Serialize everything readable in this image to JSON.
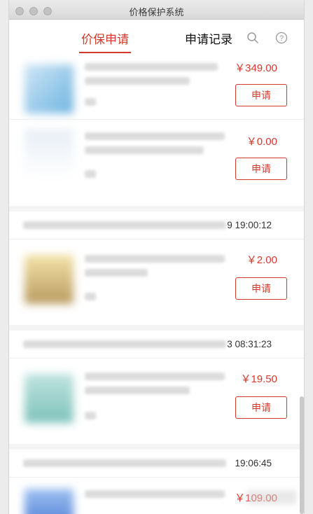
{
  "window": {
    "title": "价格保护系统"
  },
  "header": {
    "tab_apply": "价保申请",
    "tab_records": "申请记录",
    "search_icon": "search-icon",
    "help_icon": "help-icon"
  },
  "colors": {
    "accent": "#d43a2c",
    "background": "#f4f4f4"
  },
  "orders": [
    {
      "time": "",
      "items": [
        {
          "price": "￥349.00",
          "button": "申请"
        },
        {
          "price": "￥0.00",
          "button": "申请"
        }
      ]
    },
    {
      "time": "9 19:00:12",
      "items": [
        {
          "price": "￥2.00",
          "button": "申请"
        }
      ]
    },
    {
      "time": "3 08:31:23",
      "items": [
        {
          "price": "￥19.50",
          "button": "申请"
        }
      ]
    },
    {
      "time": "19:06:45",
      "items": [
        {
          "price": "￥109.00",
          "button": ""
        }
      ]
    }
  ]
}
